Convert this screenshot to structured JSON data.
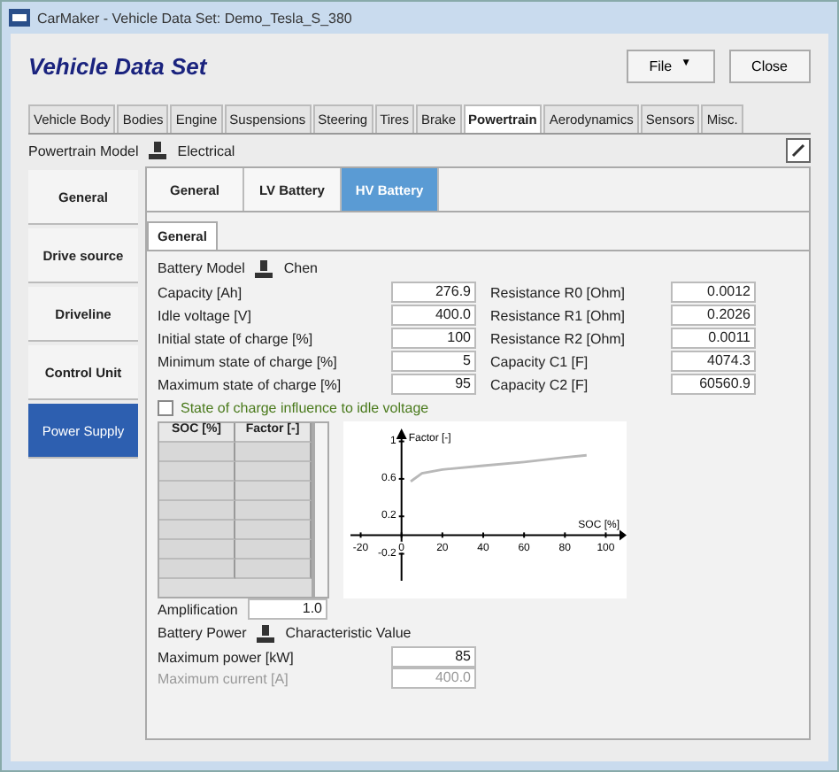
{
  "window": {
    "title": "CarMaker - Vehicle Data Set: Demo_Tesla_S_380"
  },
  "header": {
    "title": "Vehicle Data Set",
    "buttons": [
      {
        "label": "File",
        "kind": "menu",
        "icon": "▼"
      },
      {
        "label": "Close",
        "kind": "plain"
      }
    ]
  },
  "tabs": [
    {
      "label": "Vehicle Body",
      "selected": false
    },
    {
      "label": "Bodies",
      "selected": false
    },
    {
      "label": "Engine",
      "selected": false
    },
    {
      "label": "Suspensions",
      "selected": false
    },
    {
      "label": "Steering",
      "selected": false
    },
    {
      "label": "Tires",
      "selected": false
    },
    {
      "label": "Brake",
      "selected": false
    },
    {
      "label": "Powertrain",
      "selected": true
    },
    {
      "label": "Aerodynamics",
      "selected": false
    },
    {
      "label": "Sensors",
      "selected": false
    },
    {
      "label": "Misc.",
      "selected": false
    }
  ],
  "model": {
    "label": "Powertrain Model",
    "value": "Electrical"
  },
  "sidebar": {
    "items": [
      {
        "label": "General",
        "selected": false
      },
      {
        "label": "Drive source",
        "selected": false
      },
      {
        "label": "Driveline",
        "selected": false
      },
      {
        "label": "Control Unit",
        "selected": false
      },
      {
        "label": "Power Supply",
        "selected": true
      }
    ]
  },
  "subtabs": [
    {
      "label": "General",
      "selected": false
    },
    {
      "label": "LV Battery",
      "selected": false
    },
    {
      "label": "HV Battery",
      "selected": true
    }
  ],
  "inner_tab": {
    "label": "General",
    "selected": true
  },
  "battery_model": {
    "label": "Battery Model",
    "value": "Chen"
  },
  "fields_left": [
    {
      "label": "Capacity [Ah]",
      "value": "276.9"
    },
    {
      "label": "Idle voltage [V]",
      "value": "400.0"
    },
    {
      "label": "Initial state of charge [%]",
      "value": "100"
    },
    {
      "label": "Minimum state of charge [%]",
      "value": "5"
    },
    {
      "label": "Maximum state of charge [%]",
      "value": "95"
    }
  ],
  "fields_right": [
    {
      "label": "Resistance R0 [Ohm]",
      "value": "0.0012"
    },
    {
      "label": "Resistance R1 [Ohm]",
      "value": "0.2026"
    },
    {
      "label": "Resistance R2 [Ohm]",
      "value": "0.0011"
    },
    {
      "label": "Capacity C1 [F]",
      "value": "4074.3"
    },
    {
      "label": "Capacity C2 [F]",
      "value": "60560.9"
    }
  ],
  "soc_checkbox": {
    "label": "State of charge influence to idle voltage",
    "checked": false
  },
  "table": {
    "columns": [
      "SOC [%]",
      "Factor [-]"
    ]
  },
  "chart": {
    "chart_data": {
      "type": "line",
      "xlabel": "SOC [%]",
      "ylabel": "Factor [-]",
      "x": [
        5,
        10,
        20,
        40,
        60,
        80,
        90
      ],
      "series": [
        {
          "color": "#b8b8b8",
          "values": [
            0.58,
            0.66,
            0.7,
            0.74,
            0.78,
            0.83,
            0.85
          ]
        }
      ],
      "xlim": [
        -25,
        105
      ],
      "ylim": [
        -0.45,
        1.1
      ],
      "xticks": [
        -20,
        0,
        20,
        40,
        60,
        80,
        100
      ],
      "yticks": [
        {
          "value": -0.2,
          "label": "-0.2"
        },
        {
          "value": 0.2,
          "label": "0.2"
        },
        {
          "value": 0.6,
          "label": "0.6"
        },
        {
          "value": 1,
          "label": "1"
        }
      ]
    }
  },
  "amplification": {
    "label": "Amplification",
    "value": "1.0"
  },
  "battery_power": {
    "label": "Battery Power",
    "value": "Characteristic Value"
  },
  "power_fields": [
    {
      "label": "Maximum power [kW]",
      "value": "85",
      "disabled": false
    },
    {
      "label": "Maximum current [A]",
      "value": "400.0",
      "disabled": true
    }
  ]
}
